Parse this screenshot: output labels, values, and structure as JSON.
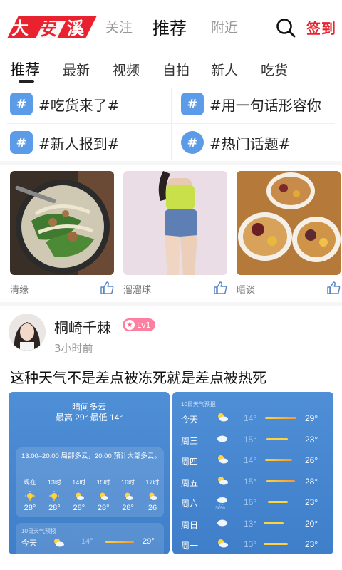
{
  "header": {
    "logo_text": "大安溪",
    "nav": [
      "关注",
      "推荐",
      "附近"
    ],
    "active_nav": "推荐",
    "signin_label": "签到"
  },
  "subtabs": [
    "推荐",
    "最新",
    "视频",
    "自拍",
    "新人",
    "吃货"
  ],
  "topics": [
    {
      "label": "#吃货来了#",
      "icon": "hashtag-icon"
    },
    {
      "label": "#用一句话形容你",
      "icon": "hashtag-icon"
    },
    {
      "label": "#新人报到#",
      "icon": "hashtag-icon"
    },
    {
      "label": "#热门话题#",
      "icon": "hashtag-round-icon"
    }
  ],
  "cards": [
    {
      "name": "清缘",
      "photo": "noodle-soup-photo"
    },
    {
      "name": "溜溜球",
      "photo": "fashion-photo"
    },
    {
      "name": "晤谈",
      "photo": "dessert-bowls-photo"
    }
  ],
  "post": {
    "username": "桐崎千棘",
    "level": "Lv1",
    "time": "3小时前",
    "text": "这种天气不是差点被冻死就是差点被热死"
  },
  "weather_today": {
    "condition": "晴间多云",
    "hilo": "最高 29° 最低 14°",
    "description": "13:00–20:00 局部多云，20:00 预计大部多云。",
    "hours": [
      {
        "time": "现在",
        "temp": "28°"
      },
      {
        "time": "13时",
        "temp": "28°"
      },
      {
        "time": "14时",
        "temp": "28°"
      },
      {
        "time": "15时",
        "temp": "28°"
      },
      {
        "time": "16时",
        "temp": "28°"
      },
      {
        "time": "17时",
        "temp": "26"
      }
    ],
    "forecast_label": "10日天气预报",
    "forecast_row": {
      "day": "今天",
      "low": "14°",
      "high": "29°"
    }
  },
  "weather_forecast": {
    "label": "10日天气预报",
    "days": [
      {
        "day": "今天",
        "low": "14°",
        "high": "29°",
        "icon": "sun-cloud-icon",
        "rain": ""
      },
      {
        "day": "周三",
        "low": "15°",
        "high": "23°",
        "icon": "cloud-icon",
        "rain": ""
      },
      {
        "day": "周四",
        "low": "14°",
        "high": "26°",
        "icon": "sun-cloud-icon",
        "rain": ""
      },
      {
        "day": "周五",
        "low": "15°",
        "high": "28°",
        "icon": "sun-cloud-icon",
        "rain": ""
      },
      {
        "day": "周六",
        "low": "16°",
        "high": "23°",
        "icon": "rain-cloud-icon",
        "rain": "30%"
      },
      {
        "day": "周日",
        "low": "13°",
        "high": "20°",
        "icon": "cloud-icon",
        "rain": ""
      },
      {
        "day": "周一",
        "low": "13°",
        "high": "23°",
        "icon": "sun-cloud-icon",
        "rain": ""
      }
    ]
  },
  "colors": {
    "brand_red": "#e8232f",
    "topic_blue": "#5b9be8",
    "badge_pink": "#ff7fa0",
    "weather_blue": "#4a89d2"
  }
}
